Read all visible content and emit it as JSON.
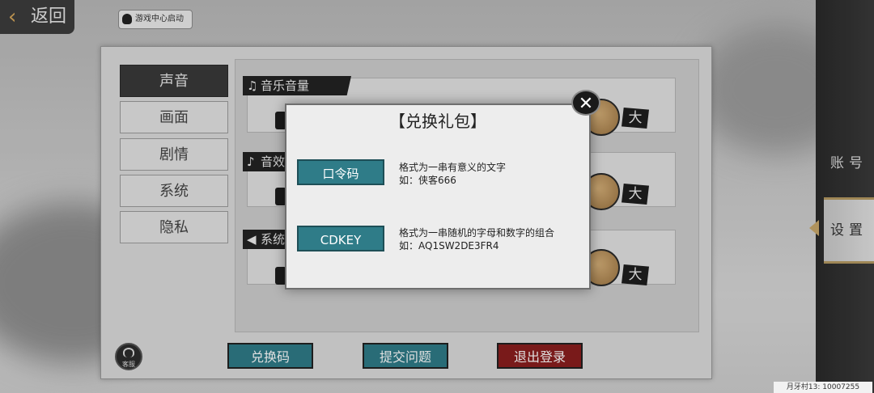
{
  "top_bar": {
    "back_label": "返回",
    "game_center_label": "游戏中心启动"
  },
  "tabs": [
    {
      "label": "声音",
      "active": true
    },
    {
      "label": "画面",
      "active": false
    },
    {
      "label": "剧情",
      "active": false
    },
    {
      "label": "系统",
      "active": false
    },
    {
      "label": "隐私",
      "active": false
    }
  ],
  "sections": [
    {
      "label": "音乐音量",
      "icon": "music-note-icon"
    },
    {
      "label": "音效",
      "icon": "sound-effect-icon"
    },
    {
      "label": "系统",
      "icon": "speaker-icon"
    }
  ],
  "slider_max_label": "大",
  "bottom_buttons": {
    "redeem": "兑换码",
    "submit_issue": "提交问题",
    "logout": "退出登录"
  },
  "support": {
    "label": "客服"
  },
  "side_nav": {
    "account": "账号",
    "settings": "设置"
  },
  "dialog": {
    "title": "【兑换礼包】",
    "close_symbol": "✕",
    "options": [
      {
        "button": "口令码",
        "line1": "格式为一串有意义的文字",
        "line2": "如：侠客666"
      },
      {
        "button": "CDKEY",
        "line1": "格式为一串随机的字母和数字的组合",
        "line2": "如：AQ1SW2DE3FR4"
      }
    ]
  },
  "footer_tag": "月牙村13: 10007255",
  "colors": {
    "teal_button": "#2f7c88",
    "red_button": "#8a1e1e",
    "active_tab": "#3a3a3a",
    "accent_gold": "#c9a86a"
  }
}
